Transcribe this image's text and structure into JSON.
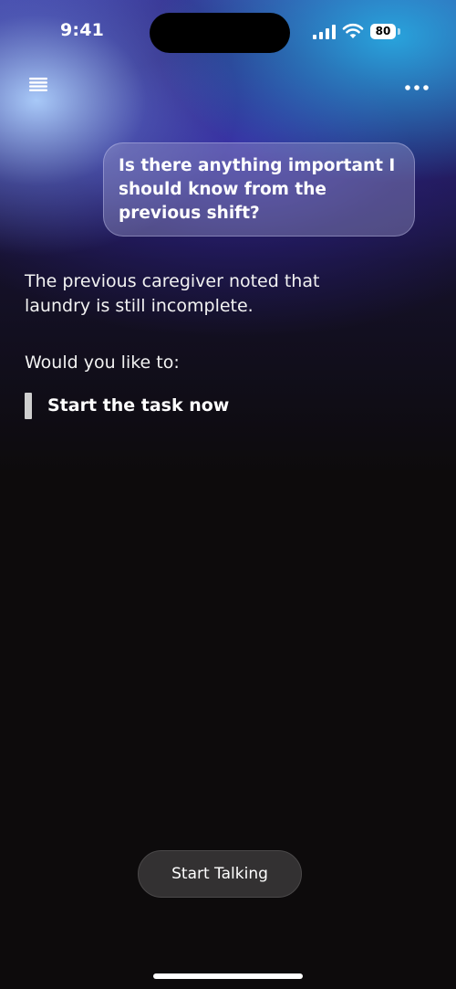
{
  "status_bar": {
    "time": "9:41",
    "battery_level": "80"
  },
  "nav": {
    "menu_icon": "hamburger-menu-icon",
    "more_icon": "more-horizontal-icon"
  },
  "conversation": {
    "user_message": "Is there anything important I should know from the previous shift?",
    "assistant_message": "The previous caregiver noted that laundry is still incomplete.",
    "assistant_question": "Would you like to:",
    "options": [
      {
        "label": "Start the task now"
      }
    ]
  },
  "footer": {
    "talk_button_label": "Start Talking"
  },
  "colors": {
    "background": "#0d0b0c",
    "glow_blue": "#28aae1",
    "glow_violet": "#3a34aa",
    "button_bg": "#333132"
  }
}
